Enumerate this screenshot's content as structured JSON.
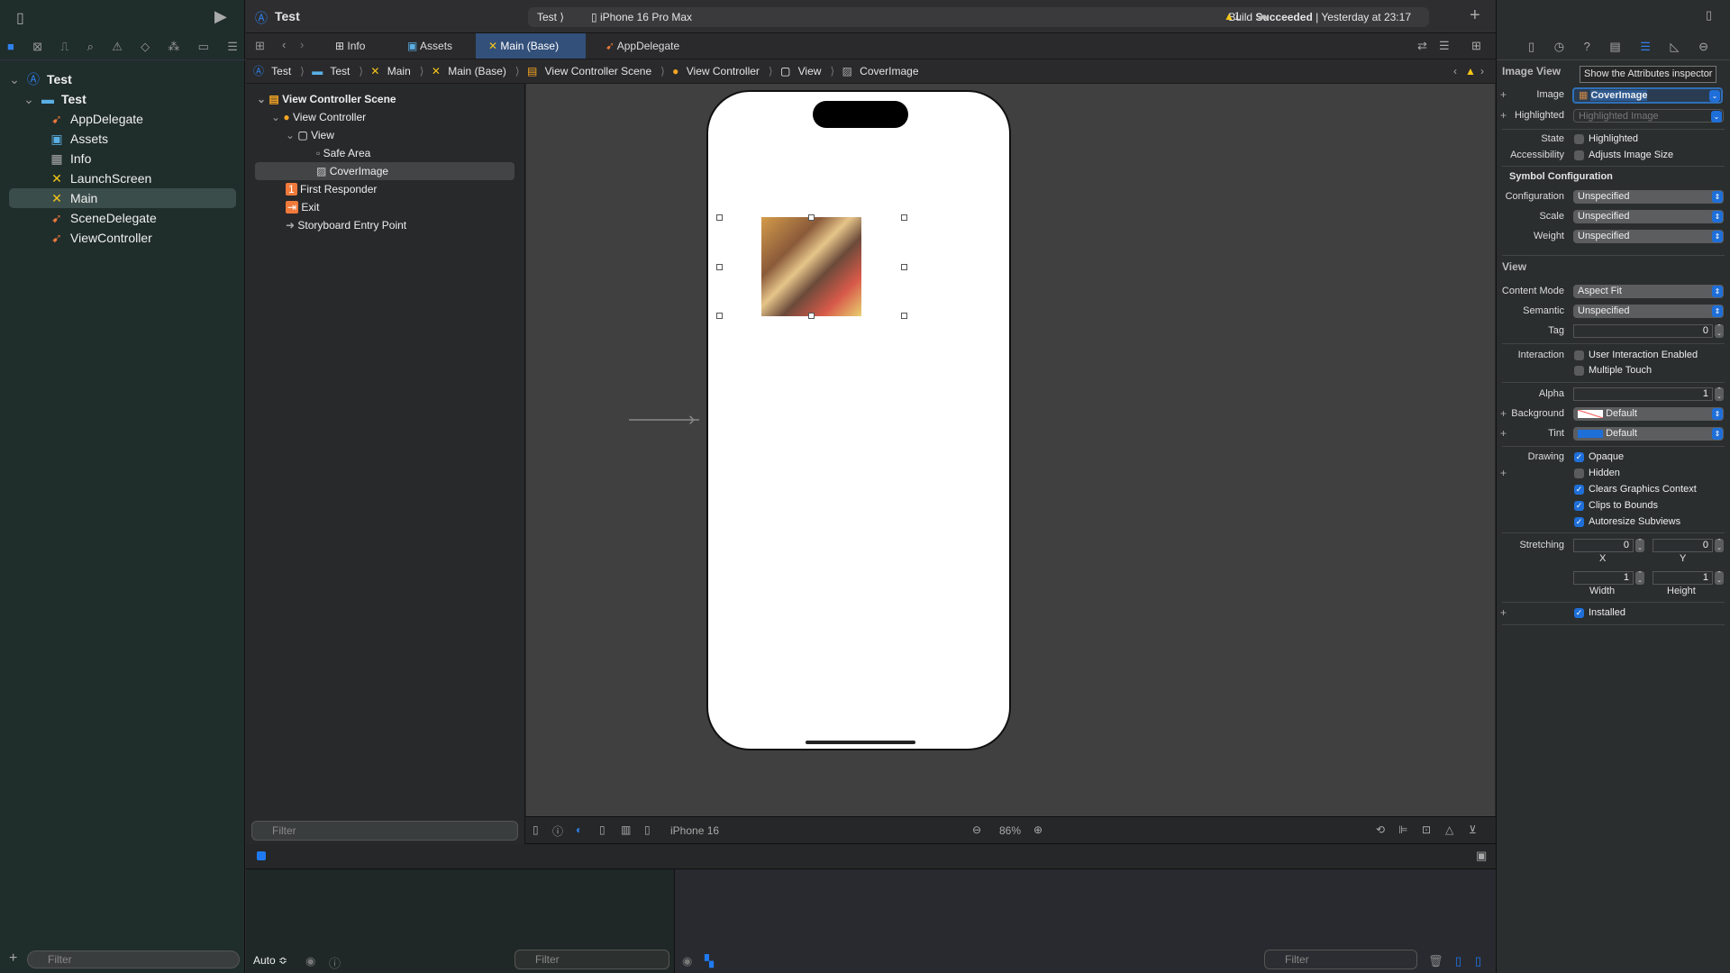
{
  "sidebar": {
    "items": [
      {
        "label": "Test",
        "icon": "project-icon"
      },
      {
        "label": "Test",
        "icon": "folder-icon"
      },
      {
        "label": "AppDelegate",
        "icon": "swift-icon"
      },
      {
        "label": "Assets",
        "icon": "assets-icon"
      },
      {
        "label": "Info",
        "icon": "plist-icon"
      },
      {
        "label": "LaunchScreen",
        "icon": "storyboard-icon"
      },
      {
        "label": "Main",
        "icon": "storyboard-icon"
      },
      {
        "label": "SceneDelegate",
        "icon": "swift-icon"
      },
      {
        "label": "ViewController",
        "icon": "swift-icon"
      }
    ],
    "selected": "Main",
    "filter_placeholder": "Filter"
  },
  "toolbar": {
    "project": "Test",
    "scheme": "Test",
    "device": "iPhone 16 Pro Max",
    "status_prefix": "Build",
    "status_bold": "Succeeded",
    "status_time": "| Yesterday at 23:17",
    "warnings": "1"
  },
  "tabs": [
    {
      "label": "Info"
    },
    {
      "label": "Assets"
    },
    {
      "label": "Main (Base)",
      "active": true
    },
    {
      "label": "AppDelegate"
    }
  ],
  "breadcrumb": [
    "Test",
    "Test",
    "Main",
    "Main (Base)",
    "View Controller Scene",
    "View Controller",
    "View",
    "CoverImage"
  ],
  "outline": {
    "items": [
      {
        "label": "View Controller Scene"
      },
      {
        "label": "View Controller"
      },
      {
        "label": "View"
      },
      {
        "label": "Safe Area"
      },
      {
        "label": "CoverImage",
        "selected": true
      },
      {
        "label": "First Responder"
      },
      {
        "label": "Exit"
      },
      {
        "label": "Storyboard Entry Point"
      }
    ],
    "filter_placeholder": "Filter"
  },
  "canvas_bar": {
    "device": "iPhone 16",
    "zoom": "86%"
  },
  "debug": {
    "auto": "Auto ≎",
    "filter_placeholder": "Filter",
    "console_filter_placeholder": "Filter"
  },
  "inspector": {
    "tooltip": "Show the Attributes inspector",
    "section_image_view": "Image View",
    "image_label": "Image",
    "image_value": "CoverImage",
    "highlighted_label": "Highlighted",
    "highlighted_placeholder": "Highlighted Image",
    "state_label": "State",
    "state_option": "Highlighted",
    "accessibility_label": "Accessibility",
    "accessibility_option": "Adjusts Image Size",
    "symbol_config": "Symbol Configuration",
    "configuration_label": "Configuration",
    "configuration_value": "Unspecified",
    "scale_label": "Scale",
    "scale_value": "Unspecified",
    "weight_label": "Weight",
    "weight_value": "Unspecified",
    "section_view": "View",
    "content_mode_label": "Content Mode",
    "content_mode_value": "Aspect Fit",
    "semantic_label": "Semantic",
    "semantic_value": "Unspecified",
    "tag_label": "Tag",
    "tag_value": "0",
    "interaction_label": "Interaction",
    "user_interaction": "User Interaction Enabled",
    "multiple_touch": "Multiple Touch",
    "alpha_label": "Alpha",
    "alpha_value": "1",
    "background_label": "Background",
    "background_value": "Default",
    "tint_label": "Tint",
    "tint_value": "Default",
    "tint_color": "#1f6fd9",
    "drawing_label": "Drawing",
    "opaque": "Opaque",
    "hidden": "Hidden",
    "clears": "Clears Graphics Context",
    "clips": "Clips to Bounds",
    "autoresize": "Autoresize Subviews",
    "stretching_label": "Stretching",
    "stretch_x": "0",
    "stretch_y": "0",
    "stretch_w": "1",
    "stretch_h": "1",
    "x_label": "X",
    "y_label": "Y",
    "width_label": "Width",
    "height_label": "Height",
    "installed": "Installed"
  },
  "colors": {
    "accent": "#1f6fd9",
    "sidebar_bg": "#1f2d2b",
    "canvas_bg": "#404040"
  }
}
